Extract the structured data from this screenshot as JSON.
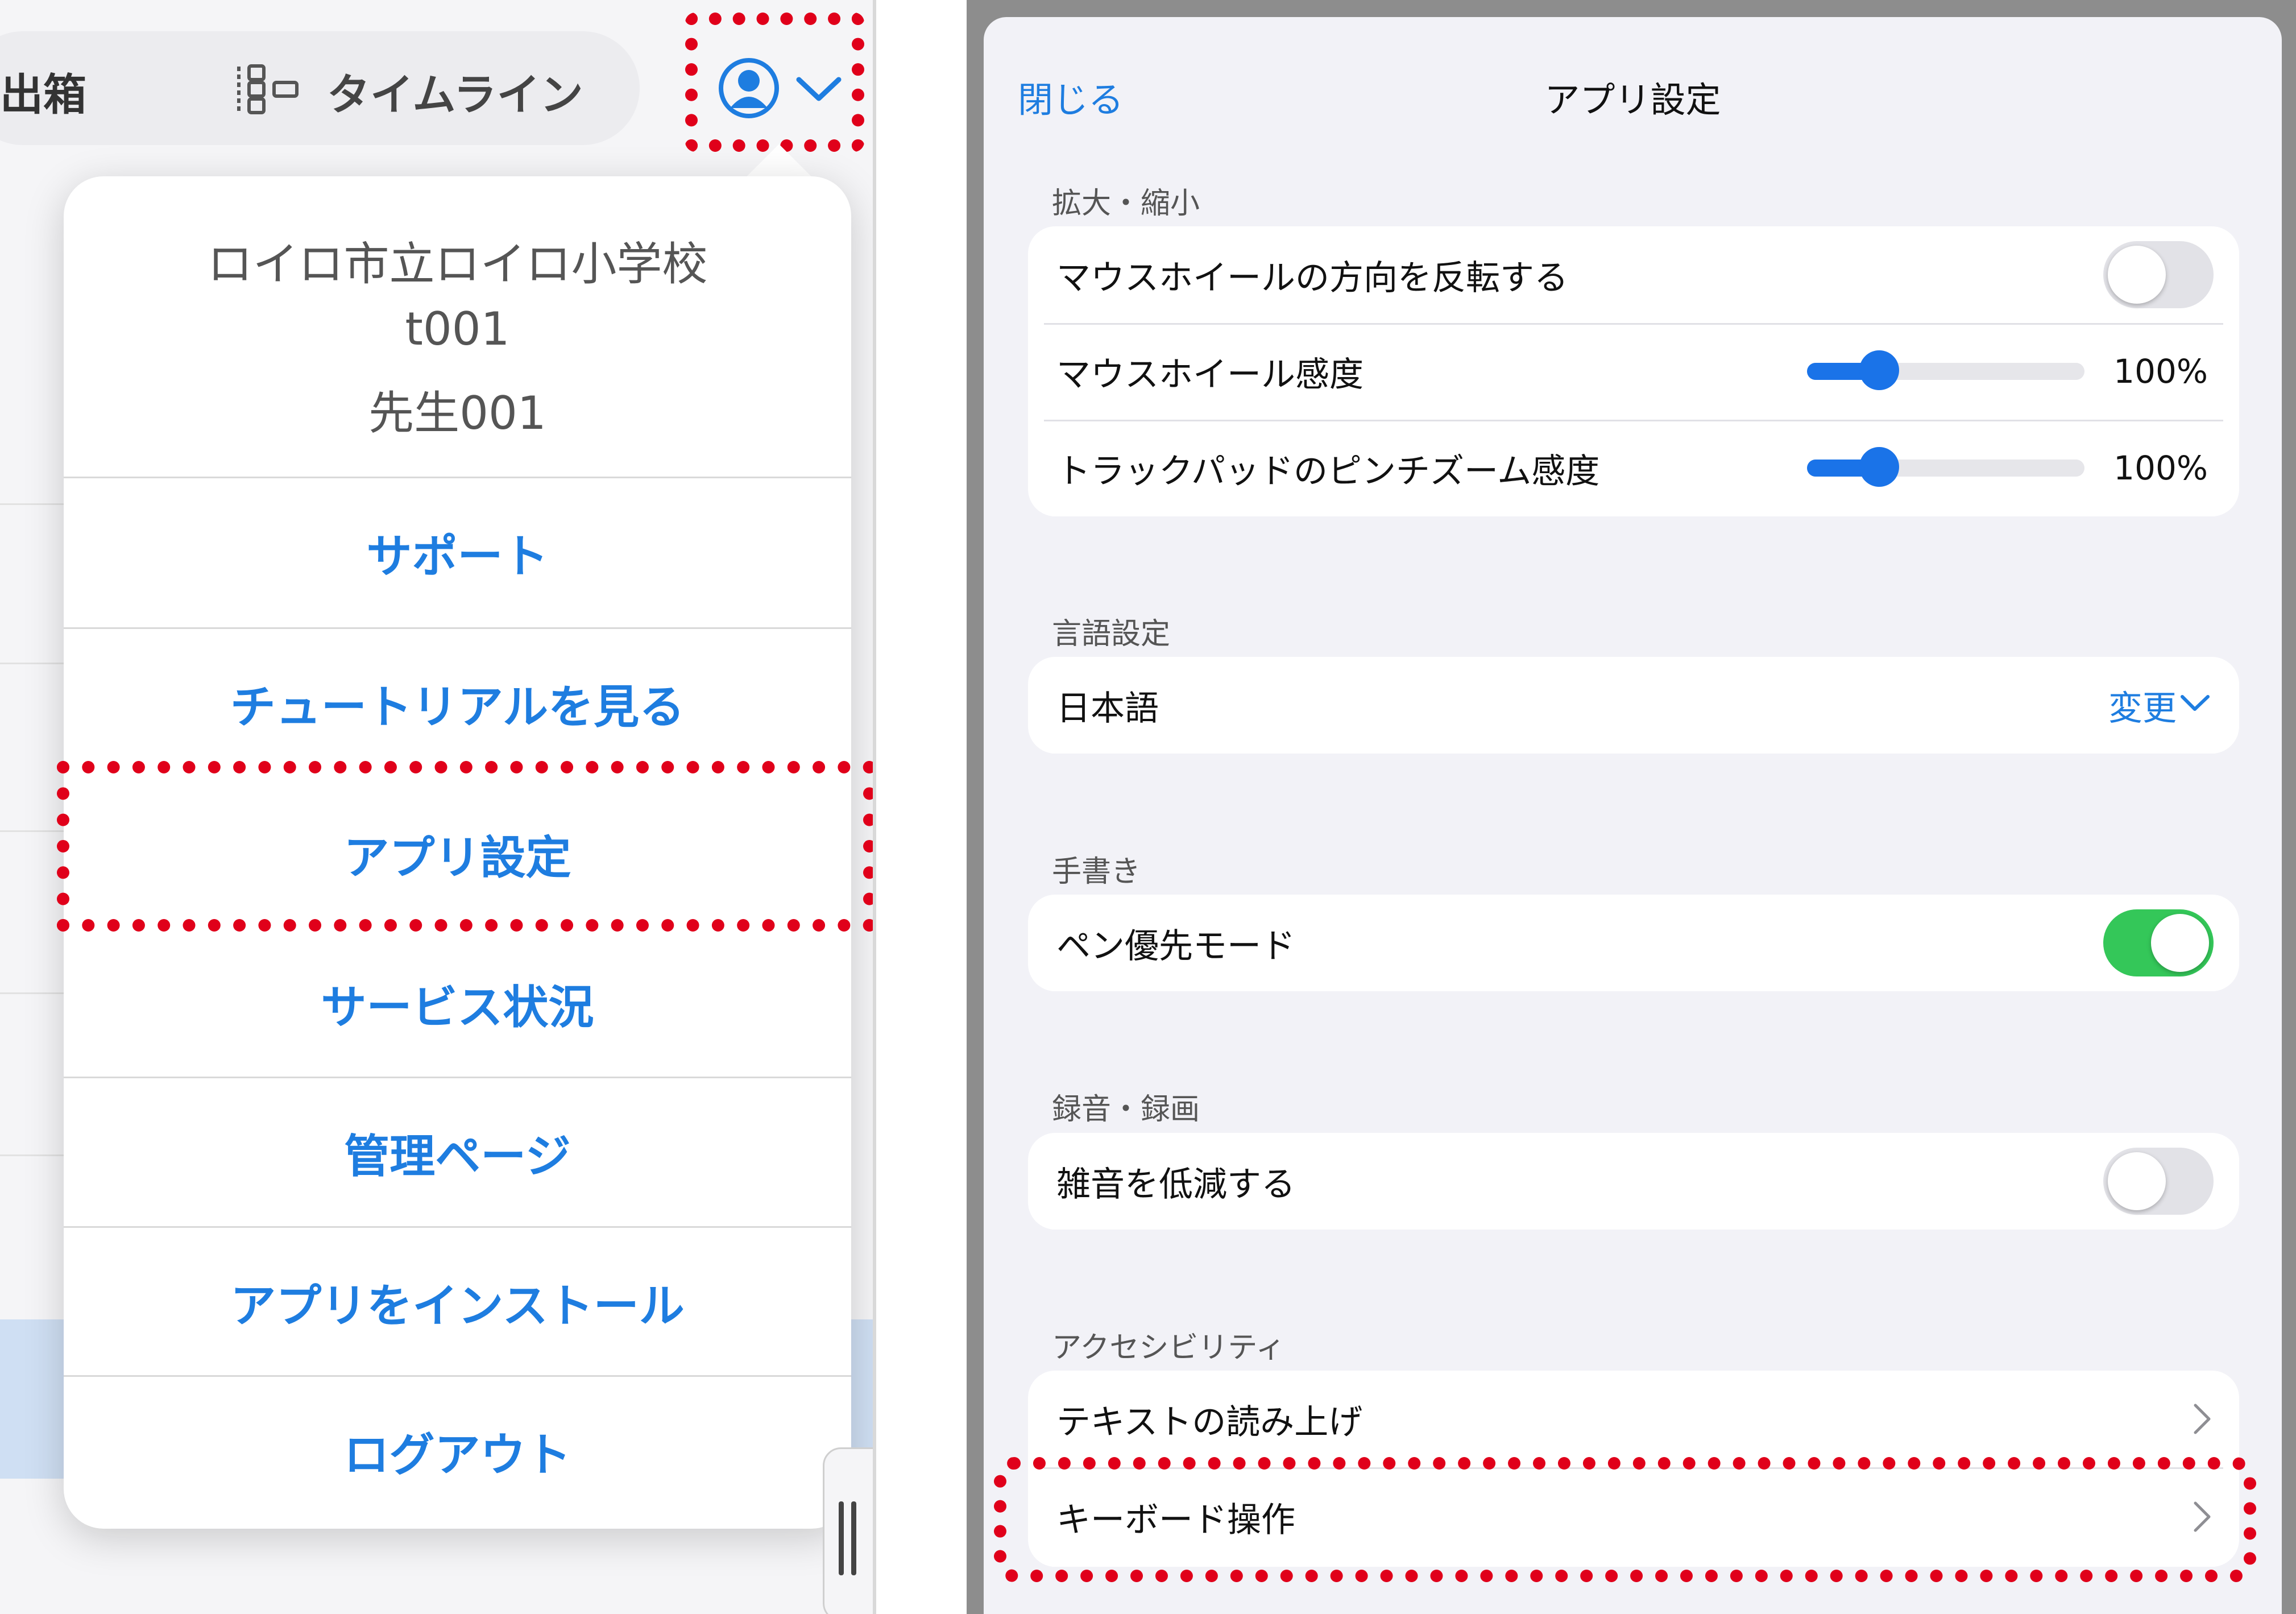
{
  "left": {
    "topbar": {
      "folder_label": "出箱",
      "timeline_label": "タイムライン"
    },
    "menu": {
      "school": "ロイロ市立ロイロ小学校",
      "user_id": "t001",
      "user_name": "先生001",
      "items": [
        {
          "label": "サポート"
        },
        {
          "label": "チュートリアルを見る"
        },
        {
          "label": "アプリ設定"
        },
        {
          "label": "サービス状況"
        },
        {
          "label": "管理ページ"
        },
        {
          "label": "アプリをインストール"
        },
        {
          "label": "ログアウト"
        }
      ]
    },
    "colors": {
      "link": "#1e7de0",
      "highlight": "#e0001a"
    }
  },
  "settings": {
    "close_label": "閉じる",
    "title": "アプリ設定",
    "sections": {
      "zoom": {
        "title": "拡大・縮小",
        "invert_label": "マウスホイールの方向を反転する",
        "invert_on": false,
        "wheel_label": "マウスホイール感度",
        "wheel_value": "100%",
        "wheel_level": 0.26,
        "pinch_label": "トラックパッドのピンチズーム感度",
        "pinch_value": "100%",
        "pinch_level": 0.26
      },
      "language": {
        "title": "言語設定",
        "current": "日本語",
        "change_label": "変更"
      },
      "handwriting": {
        "title": "手書き",
        "pen_label": "ペン優先モード",
        "pen_on": true
      },
      "recording": {
        "title": "録音・録画",
        "noise_label": "雑音を低減する",
        "noise_on": false
      },
      "accessibility": {
        "title": "アクセシビリティ",
        "tts_label": "テキストの読み上げ",
        "keyboard_label": "キーボード操作"
      }
    },
    "colors": {
      "toggle_on": "#34c759",
      "slider": "#1a73e8"
    }
  }
}
